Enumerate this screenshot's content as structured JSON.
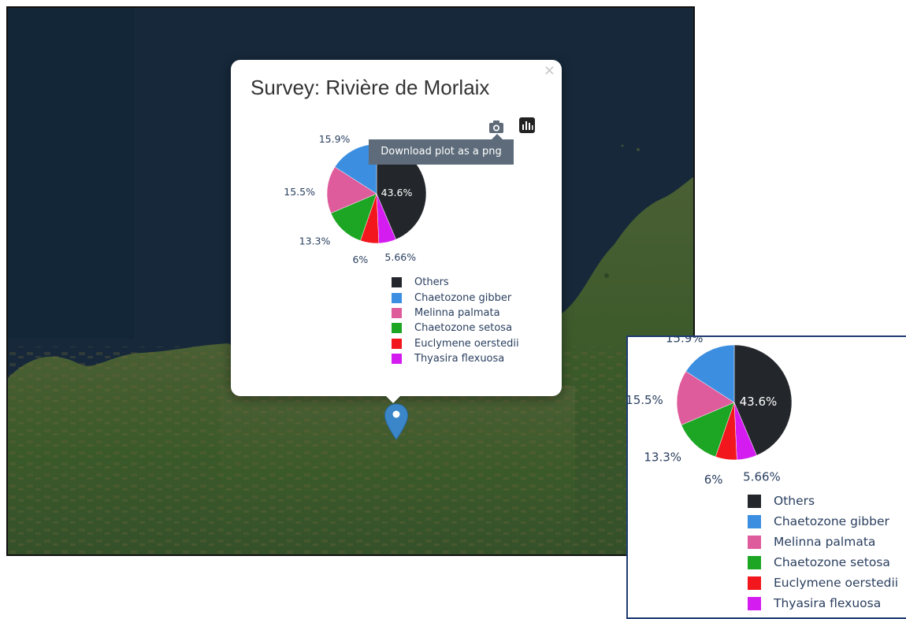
{
  "map": {
    "background_colors": {
      "sea": "#16283a",
      "land": "#3e5a2c"
    }
  },
  "popup": {
    "title": "Survey: Rivière de Morlaix",
    "close_icon": "×",
    "modebar": {
      "download_icon": "camera-icon",
      "logo_icon": "plotly-logo-icon",
      "tooltip": "Download plot as a png"
    }
  },
  "chart_data": {
    "type": "pie",
    "title": "",
    "slices": [
      {
        "label": "Others",
        "value": 43.6,
        "text": "43.6%",
        "color": "#23262b"
      },
      {
        "label": "Thyasira flexuosa",
        "value": 5.66,
        "text": "5.66%",
        "color": "#d41cf1"
      },
      {
        "label": "Euclymene oerstedii",
        "value": 6.0,
        "text": "6%",
        "color": "#f2171c"
      },
      {
        "label": "Chaetozone setosa",
        "value": 13.3,
        "text": "13.3%",
        "color": "#1ca624"
      },
      {
        "label": "Melinna palmata",
        "value": 15.5,
        "text": "15.5%",
        "color": "#df5c9c"
      },
      {
        "label": "Chaetozone gibber",
        "value": 15.9,
        "text": "15.9%",
        "color": "#3c8ee0"
      }
    ],
    "legend": [
      {
        "label": "Others",
        "color": "#23262b"
      },
      {
        "label": "Chaetozone gibber",
        "color": "#3c8ee0"
      },
      {
        "label": "Melinna palmata",
        "color": "#df5c9c"
      },
      {
        "label": "Chaetozone setosa",
        "color": "#1ca624"
      },
      {
        "label": "Euclymene oerstedii",
        "color": "#f2171c"
      },
      {
        "label": "Thyasira flexuosa",
        "color": "#d41cf1"
      }
    ],
    "legend_placement": "bottom"
  },
  "marker": {
    "icon": "map-pin-icon",
    "color": "#3a86c8"
  }
}
